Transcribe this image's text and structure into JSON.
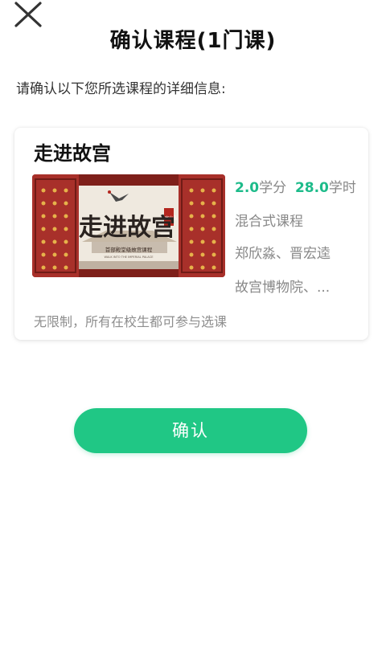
{
  "header": {
    "title": "确认课程(1门课)",
    "close_icon": "close-icon"
  },
  "instruction": "请确认以下您所选课程的详细信息:",
  "course": {
    "name": "走进故宫",
    "thumbnail": {
      "title_chars": "走进故宫",
      "stamp": "故宫出品",
      "subtitle": "首部殿堂级故宫课程",
      "subtitle_en": "WALK INTO THE IMPERIAL PALACE"
    },
    "credits_value": "2.0",
    "credits_unit": "学分",
    "hours_value": "28.0",
    "hours_unit": "学时",
    "type": "混合式课程",
    "teachers": "郑欣淼、晋宏逵",
    "school": "故宫博物院、...",
    "restriction": "无限制，所有在校生都可参与选课"
  },
  "actions": {
    "confirm_label": "确认"
  },
  "colors": {
    "accent_green": "#20c785",
    "number_green": "#1dbb8a",
    "palace_red": "#a8302a"
  }
}
